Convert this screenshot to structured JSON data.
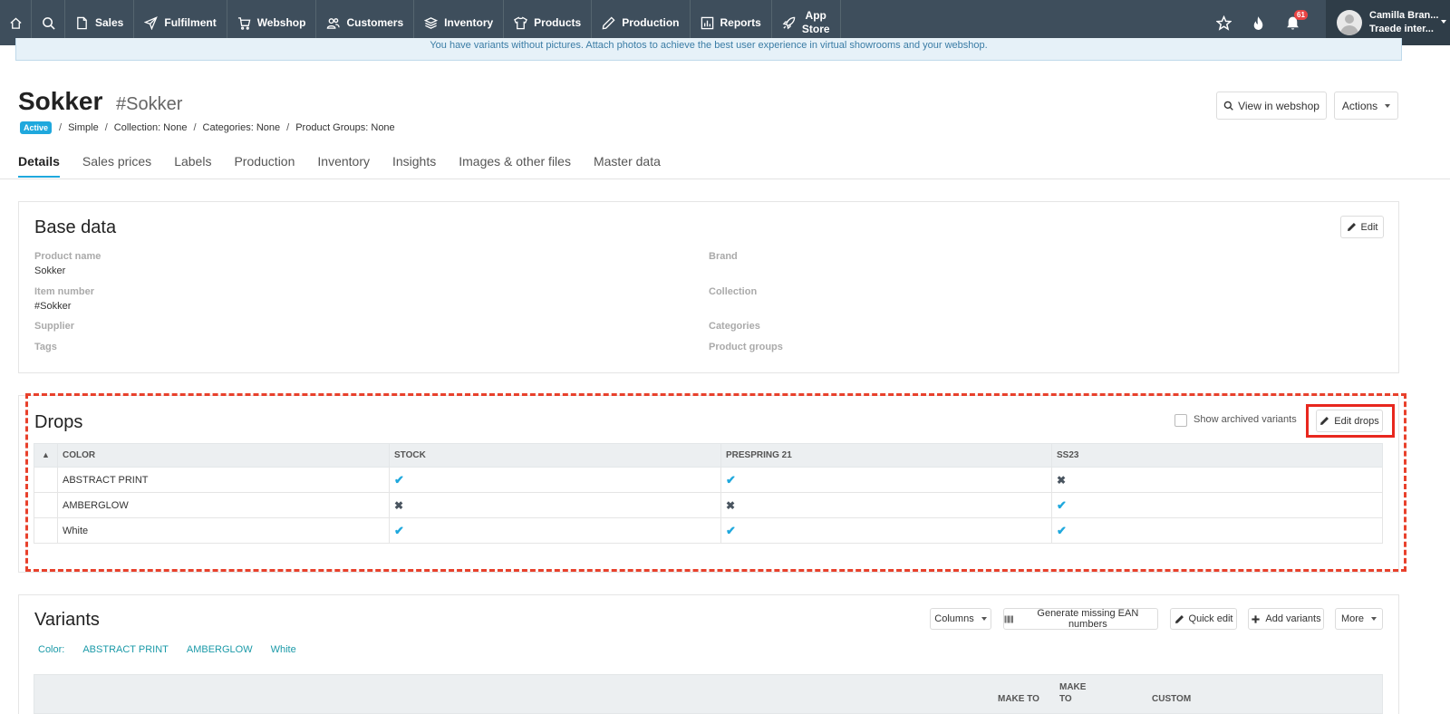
{
  "nav": {
    "items": [
      {
        "label": "Sales",
        "icon": "file-icon"
      },
      {
        "label": "Fulfilment",
        "icon": "paper-plane-icon"
      },
      {
        "label": "Webshop",
        "icon": "cart-icon"
      },
      {
        "label": "Customers",
        "icon": "users-icon"
      },
      {
        "label": "Inventory",
        "icon": "boxes-icon"
      },
      {
        "label": "Products",
        "icon": "tshirt-icon"
      },
      {
        "label": "Production",
        "icon": "pencil-icon"
      },
      {
        "label": "Reports",
        "icon": "bar-chart-icon"
      }
    ],
    "app_store_line1": "App",
    "app_store_line2": "Store",
    "notification_count": "61",
    "user_name": "Camilla Bran...",
    "user_company": "Traede inter..."
  },
  "banner": {
    "text": "You have variants without pictures. Attach photos to achieve the best user experience in virtual showrooms and your webshop."
  },
  "header": {
    "title": "Sokker",
    "sku": "#Sokker",
    "status": "Active",
    "type": "Simple",
    "collection": "Collection: None",
    "categories": "Categories: None",
    "product_groups": "Product Groups: None",
    "view_webshop": "View in webshop",
    "actions": "Actions"
  },
  "tabs": [
    "Details",
    "Sales prices",
    "Labels",
    "Production",
    "Inventory",
    "Insights",
    "Images & other files",
    "Master data"
  ],
  "base_data": {
    "title": "Base data",
    "edit": "Edit",
    "product_name_label": "Product name",
    "product_name_value": "Sokker",
    "item_number_label": "Item number",
    "item_number_value": "#Sokker",
    "supplier_label": "Supplier",
    "tags_label": "Tags",
    "brand_label": "Brand",
    "collection_label": "Collection",
    "categories_label": "Categories",
    "product_groups_label": "Product groups"
  },
  "drops": {
    "title": "Drops",
    "show_archived": "Show archived variants",
    "edit_drops": "Edit drops",
    "columns": [
      "COLOR",
      "STOCK",
      "PRESPRING 21",
      "SS23"
    ],
    "rows": [
      {
        "color": "ABSTRACT PRINT",
        "stock": true,
        "prespring": true,
        "ss23": false
      },
      {
        "color": "AMBERGLOW",
        "stock": false,
        "prespring": false,
        "ss23": true
      },
      {
        "color": "White",
        "stock": true,
        "prespring": true,
        "ss23": true
      }
    ]
  },
  "variants": {
    "title": "Variants",
    "columns_btn": "Columns",
    "generate_ean": "Generate missing EAN numbers",
    "quick_edit": "Quick edit",
    "add_variants": "Add variants",
    "more": "More",
    "filter_label": "Color:",
    "filters": [
      "ABSTRACT PRINT",
      "AMBERGLOW",
      "White"
    ],
    "head_make_to": "MAKE TO",
    "head_make_to_2a": "MAKE",
    "head_make_to_2b": "TO",
    "head_custom": "CUSTOM"
  }
}
